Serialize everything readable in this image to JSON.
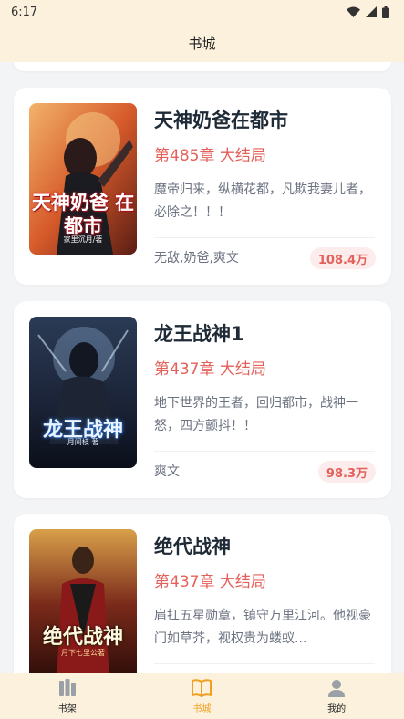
{
  "status_bar": {
    "time": "6:17"
  },
  "header": {
    "title": "书城"
  },
  "books": [
    {
      "title": "天神奶爸在都市",
      "chapter": "第485章 大结局",
      "description": "魔帝归来，纵横花都，凡欺我妻儿者，必除之！！！",
      "tags": "无敌,奶爸,爽文",
      "count": "108.4万",
      "cover_text": "天神奶爸 在都市",
      "cover_author": "家里沉月/著"
    },
    {
      "title": "龙王战神1",
      "chapter": "第437章 大结局",
      "description": "地下世界的王者，回归都市，战神一怒，四方颤抖！！",
      "tags": "爽文",
      "count": "98.3万",
      "cover_text": "龙王战神",
      "cover_author": "月间枝 著"
    },
    {
      "title": "绝代战神",
      "chapter": "第437章 大结局",
      "description": "肩扛五星勋章，镇守万里江河。他视豪门如草芥，视权贵为蝼蚁...",
      "tags": "",
      "count": "",
      "cover_text": "绝代战神",
      "cover_author": "月下七里公著"
    }
  ],
  "tabbar": {
    "items": [
      {
        "label": "书架",
        "icon": "bookshelf-icon"
      },
      {
        "label": "书城",
        "icon": "book-open-icon"
      },
      {
        "label": "我的",
        "icon": "user-icon"
      }
    ],
    "active": "书城",
    "active_color": "#f0a020"
  },
  "colors": {
    "accent": "#e4605a",
    "bar_bg": "#fbf1dc"
  }
}
